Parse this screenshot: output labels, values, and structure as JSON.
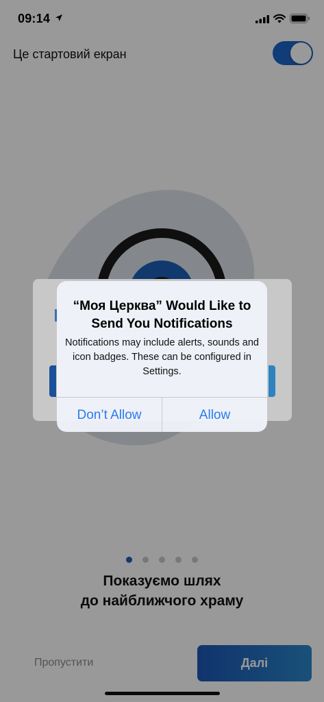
{
  "status_bar": {
    "time": "09:14",
    "icons": [
      "location-arrow-icon",
      "cellular-signal-icon",
      "wifi-icon",
      "battery-icon"
    ]
  },
  "start_screen": {
    "label": "Це стартовий екран",
    "toggle_on": true
  },
  "pagination": {
    "total": 5,
    "active_index": 0
  },
  "headline": {
    "line1": "Показуємо шлях",
    "line2": "до найближчого храму"
  },
  "buttons": {
    "skip": "Пропустити",
    "next": "Далі"
  },
  "alert": {
    "title": "“Моя Церква” Would Like to Send You Notifications",
    "message": "Notifications may include alerts, sounds and icon badges. These can be configured in Settings.",
    "dont_allow": "Don’t Allow",
    "allow": "Allow"
  },
  "colors": {
    "accent": "#1c64c8",
    "alert_button": "#2a7bf0",
    "dot_active": "#1d5fb8",
    "dot_inactive": "#c9c9cf"
  }
}
